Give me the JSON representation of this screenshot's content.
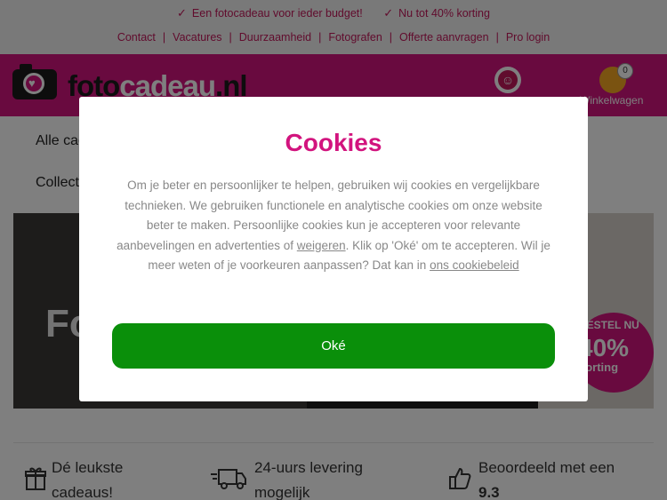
{
  "topbar": {
    "usps": [
      {
        "icon": "check-icon",
        "label": "Een fotocadeau voor ieder budget!"
      },
      {
        "icon": "check-icon",
        "label": "Nu tot 40% korting"
      }
    ],
    "links": [
      "Contact",
      "Vacatures",
      "Duurzaamheid",
      "Fotografen",
      "Offerte aanvragen",
      "Pro login"
    ],
    "separator": "|"
  },
  "header": {
    "logo_text_1": "foto",
    "logo_text_2": "cadeau",
    "logo_text_3": ".nl",
    "cart_count": "0",
    "cart_label": "Winkelwagen"
  },
  "nav": {
    "items": [
      "Alle cadeaus",
      "Collecties"
    ]
  },
  "banner": {
    "left_text": "Foto",
    "badge_line1": "BESTEL NU",
    "badge_line2": "40%",
    "badge_line3": "korting"
  },
  "features": [
    {
      "icon": "gift-icon",
      "label": "Dé leukste cadeaus!"
    },
    {
      "icon": "truck-icon",
      "label": "24-uurs levering mogelijk"
    },
    {
      "icon": "thumbs-up-icon",
      "label": "Beoordeeld met een",
      "score": "9.3"
    }
  ],
  "modal": {
    "title": "Cookies",
    "text_1": "Om je beter en persoonlijker te helpen, gebruiken wij cookies en vergelijkbare technieken. We gebruiken functionele en analytische cookies om onze website beter te maken. Persoonlijke cookies kun je accepteren voor relevante aanbevelingen en advertenties of ",
    "refuse_link": "weigeren",
    "text_2": ". Klik op 'Oké' om te accepteren. Wil je meer weten of je voorkeuren aanpassen? Dat kan in ",
    "policy_link": "ons cookiebeleid",
    "ok_label": "Oké"
  },
  "colors": {
    "brand_pink": "#d2147e",
    "ok_green": "#0a8f0a"
  }
}
